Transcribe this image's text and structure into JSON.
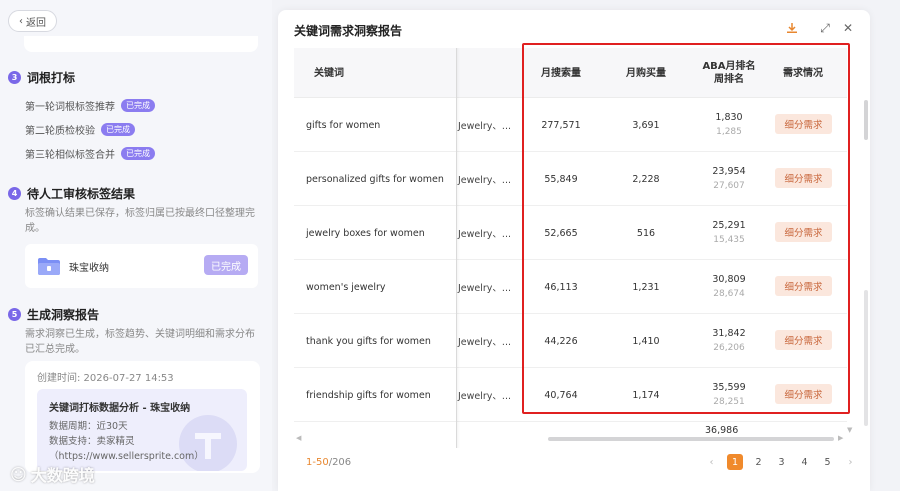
{
  "left": {
    "back_label": "返回",
    "steps": [
      {
        "num": "3",
        "title": "词根打标"
      },
      {
        "num": "4",
        "title": "待人工审核标签结果"
      },
      {
        "num": "5",
        "title": "生成洞察报告"
      }
    ],
    "step3_items": [
      {
        "label": "第一轮词根标签推荐",
        "badge": "已完成"
      },
      {
        "label": "第二轮质检校验",
        "badge": "已完成"
      },
      {
        "label": "第三轮相似标签合并",
        "badge": "已完成"
      }
    ],
    "step4_desc": "标签确认结果已保存，标签归属已按最终口径整理完成。",
    "step4_card_label": "珠宝收纳",
    "step4_card_button": "已完成",
    "step5_desc": "需求洞察已生成，标签趋势、关键词明细和需求分布已汇总完成。",
    "created_time": "创建时间: 2026-07-27 14:53",
    "report_title": "关键词打标数据分析 - 珠宝收纳",
    "report_period": "数据周期：近30天",
    "report_support": "数据支持：卖家精灵",
    "report_url": "（https://www.sellersprite.com）",
    "watermark": "大数跨境"
  },
  "modal": {
    "title": "关键词需求洞察报告",
    "columns": {
      "keyword": "关键词",
      "monthly_search": "月搜索量",
      "monthly_purchase": "月购买量",
      "aba_rank_line1": "ABA月排名",
      "aba_rank_line2": "周排名",
      "demand": "需求情况"
    },
    "rows": [
      {
        "keyword": "gifts for women",
        "category": "Jewelry、...",
        "search": "277,571",
        "purchase": "3,691",
        "aba_month": "1,830",
        "aba_week": "1,285",
        "demand": "细分需求"
      },
      {
        "keyword": "personalized gifts for women",
        "category": "Jewelry、...",
        "search": "55,849",
        "purchase": "2,228",
        "aba_month": "23,954",
        "aba_week": "27,607",
        "demand": "细分需求"
      },
      {
        "keyword": "jewelry boxes for women",
        "category": "Jewelry、...",
        "search": "52,665",
        "purchase": "516",
        "aba_month": "25,291",
        "aba_week": "15,435",
        "demand": "细分需求"
      },
      {
        "keyword": "women's jewelry",
        "category": "Jewelry、...",
        "search": "46,113",
        "purchase": "1,231",
        "aba_month": "30,809",
        "aba_week": "28,674",
        "demand": "细分需求"
      },
      {
        "keyword": "thank you gifts for women",
        "category": "Jewelry、...",
        "search": "44,226",
        "purchase": "1,410",
        "aba_month": "31,842",
        "aba_week": "26,206",
        "demand": "细分需求"
      },
      {
        "keyword": "friendship gifts for women",
        "category": "Jewelry、...",
        "search": "40,764",
        "purchase": "1,174",
        "aba_month": "35,599",
        "aba_week": "28,251",
        "demand": "细分需求"
      }
    ],
    "partial_row_value": "36,986",
    "pagination": {
      "range": "1-50",
      "total": "/206",
      "pages": [
        "1",
        "2",
        "3",
        "4",
        "5"
      ],
      "active": "1"
    }
  }
}
